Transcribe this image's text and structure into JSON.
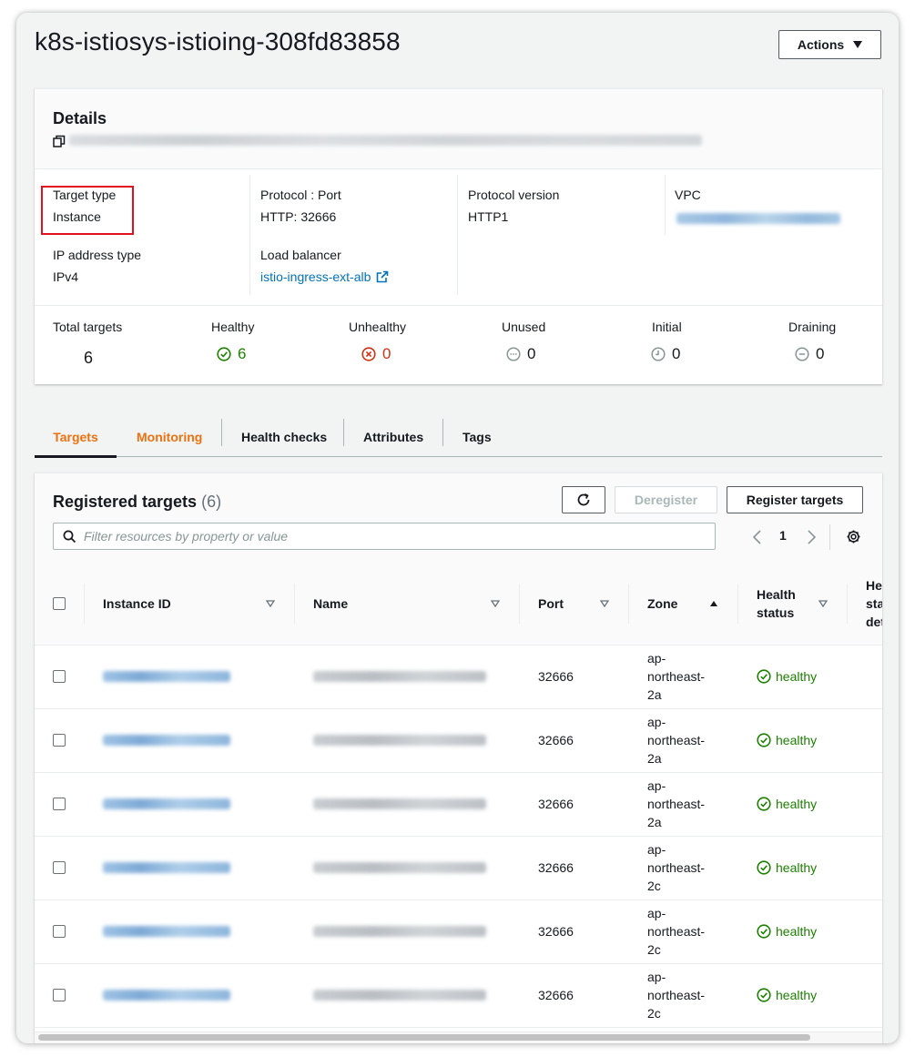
{
  "page": {
    "title": "k8s-istiosys-istioing-308fd83858",
    "actions_label": "Actions"
  },
  "details": {
    "title": "Details",
    "target_type": {
      "label": "Target type",
      "value": "Instance"
    },
    "protocol_port": {
      "label": "Protocol : Port",
      "value": "HTTP: 32666"
    },
    "protocol_version": {
      "label": "Protocol version",
      "value": "HTTP1"
    },
    "vpc": {
      "label": "VPC"
    },
    "ip_address_type": {
      "label": "IP address type",
      "value": "IPv4"
    },
    "load_balancer": {
      "label": "Load balancer",
      "value": "istio-ingress-ext-alb"
    },
    "counts": [
      {
        "label": "Total targets",
        "value": "6",
        "icon": "none",
        "color": "#16191f"
      },
      {
        "label": "Healthy",
        "value": "6",
        "icon": "check-circle-icon",
        "color": "#1d8102"
      },
      {
        "label": "Unhealthy",
        "value": "0",
        "icon": "x-circle-icon",
        "color": "#d13212"
      },
      {
        "label": "Unused",
        "value": "0",
        "icon": "dots-circle-icon",
        "color": "#16191f"
      },
      {
        "label": "Initial",
        "value": "0",
        "icon": "clock-circle-icon",
        "color": "#16191f"
      },
      {
        "label": "Draining",
        "value": "0",
        "icon": "minus-circle-icon",
        "color": "#16191f"
      }
    ]
  },
  "tabs": [
    "Targets",
    "Monitoring",
    "Health checks",
    "Attributes",
    "Tags"
  ],
  "targets": {
    "title": "Registered targets",
    "count": "(6)",
    "deregister_label": "Deregister",
    "register_label": "Register targets",
    "filter_placeholder": "Filter resources by property or value",
    "page": "1",
    "columns": [
      "Instance ID",
      "Name",
      "Port",
      "Zone",
      "Health status",
      "Health status details"
    ],
    "rows": [
      {
        "port": "32666",
        "zone": [
          "ap-",
          "northeast-",
          "2a"
        ],
        "health": "healthy"
      },
      {
        "port": "32666",
        "zone": [
          "ap-",
          "northeast-",
          "2a"
        ],
        "health": "healthy"
      },
      {
        "port": "32666",
        "zone": [
          "ap-",
          "northeast-",
          "2a"
        ],
        "health": "healthy"
      },
      {
        "port": "32666",
        "zone": [
          "ap-",
          "northeast-",
          "2c"
        ],
        "health": "healthy"
      },
      {
        "port": "32666",
        "zone": [
          "ap-",
          "northeast-",
          "2c"
        ],
        "health": "healthy"
      },
      {
        "port": "32666",
        "zone": [
          "ap-",
          "northeast-",
          "2c"
        ],
        "health": "healthy"
      }
    ]
  },
  "colors": {
    "accent": "#ec7211",
    "link": "#0073bb",
    "healthy": "#1d8102",
    "unhealthy": "#d13212",
    "highlight": "#e0101f"
  }
}
